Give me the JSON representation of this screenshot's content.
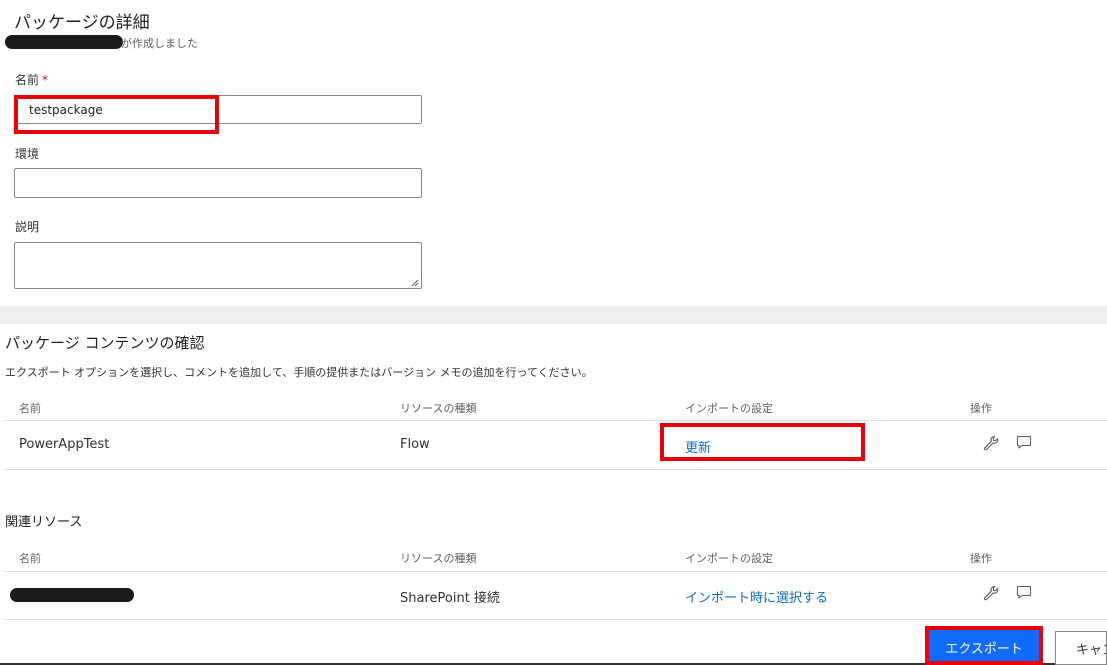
{
  "details": {
    "title": "パッケージの詳細",
    "created_suffix": "が作成しました"
  },
  "form": {
    "name_label": "名前",
    "required_mark": "*",
    "name_value": "testpackage",
    "environment_label": "環境",
    "environment_value": "",
    "description_label": "説明",
    "description_value": ""
  },
  "contents": {
    "title": "パッケージ コンテンツの確認",
    "description": "エクスポート オプションを選択し、コメントを追加して、手順の提供またはバージョン メモの追加を行ってください。",
    "columns": [
      "名前",
      "リソースの種類",
      "インポートの設定",
      "操作"
    ],
    "rows": [
      {
        "name": "PowerAppTest",
        "type": "Flow",
        "import_setting": "更新"
      }
    ]
  },
  "related": {
    "title": "関連リソース",
    "columns": [
      "名前",
      "リソースの種類",
      "インポートの設定",
      "操作"
    ],
    "rows": [
      {
        "name": "",
        "type": "SharePoint 接続",
        "import_setting": "インポート時に選択する"
      }
    ]
  },
  "footer": {
    "export_label": "エクスポート",
    "cancel_label": "キャンセル"
  },
  "icons": {
    "action_settings": "wrench-icon",
    "action_comment": "comment-icon"
  },
  "colors": {
    "accent": "#0f6cff",
    "link": "#0f6cbd",
    "highlight": "#e8000b",
    "required": "#a4262c"
  }
}
